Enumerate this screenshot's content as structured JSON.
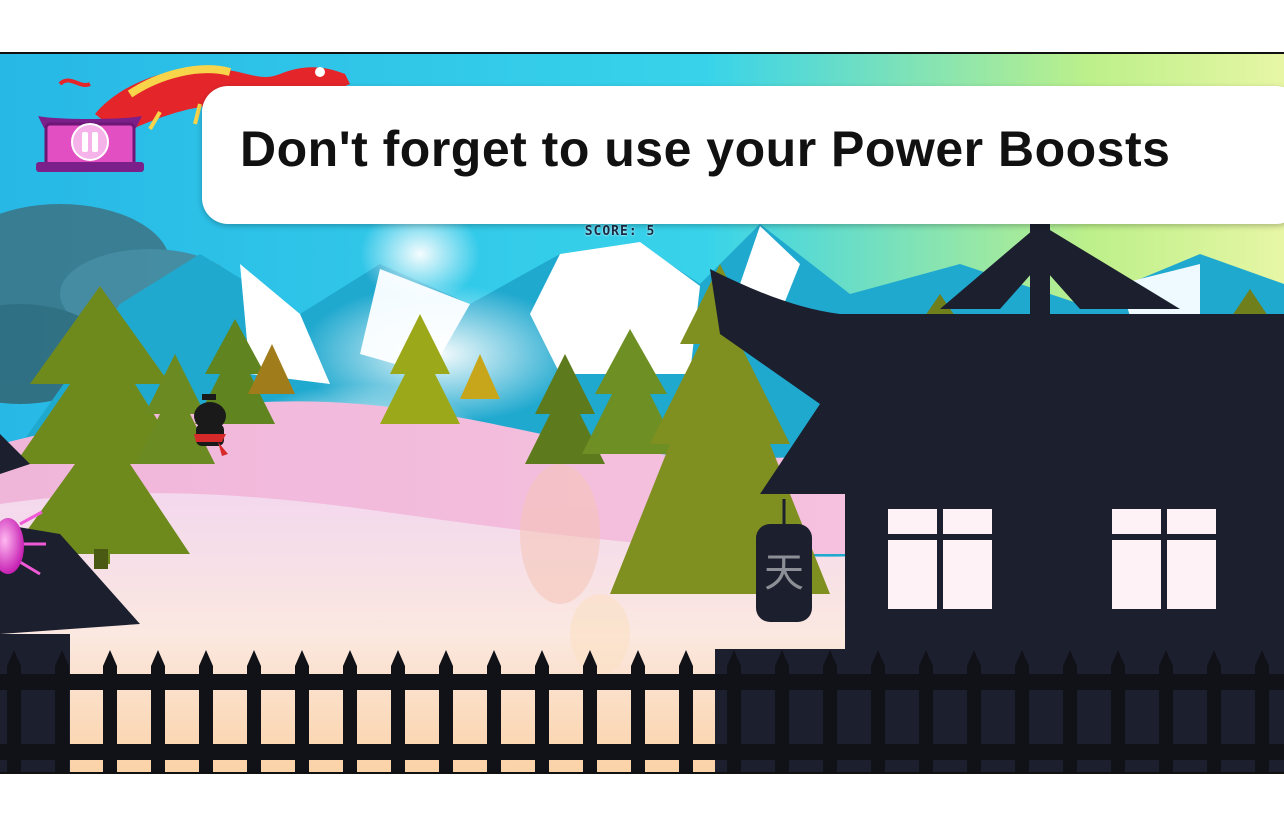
{
  "game": {
    "tip_message": "Don't forget to use your Power Boosts",
    "score_text": "SCORE: 5",
    "lantern_character": "天"
  },
  "icons": {
    "pause": "pause-icon",
    "dragon": "dragon-icon",
    "ninja": "ninja-player",
    "pagoda": "pagoda-silhouette",
    "lantern": "lantern-icon",
    "fence": "fence-silhouette",
    "boost": "power-boost-orb"
  },
  "colors": {
    "sky": "#29c7e8",
    "silhouette": "#1b1f2e",
    "pause_pink": "#e24fc2",
    "dragon_red": "#e4262b",
    "tree_green": "#7f8f20"
  }
}
